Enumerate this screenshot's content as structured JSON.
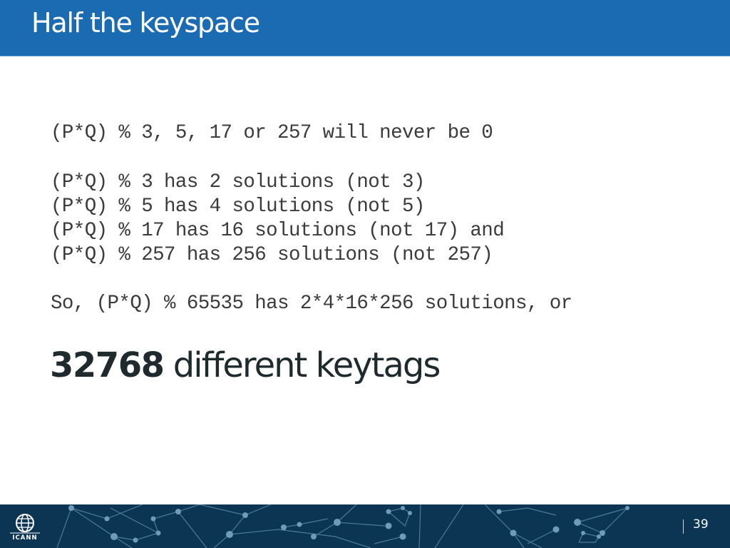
{
  "slide": {
    "title": "Half the keyspace",
    "body_lines": [
      "(P*Q) % 3, 5, 17 or 257 will never be 0",
      "(P*Q) % 3 has 2 solutions (not 3)",
      "(P*Q) % 5 has 4 solutions (not 5)",
      "(P*Q) % 17 has 16 solutions (not 17) and",
      "(P*Q) % 257 has 256 solutions (not 257)",
      "So, (P*Q) % 65535 has 2*4*16*256 solutions, or"
    ],
    "conclusion": {
      "number": "32768",
      "text": " different keytags"
    }
  },
  "footer": {
    "logo_text": "ICANN",
    "page_number": "39"
  },
  "colors": {
    "title_bar": "#1b6bb3",
    "footer": "#0c3553",
    "network": "#6f9ab8"
  }
}
